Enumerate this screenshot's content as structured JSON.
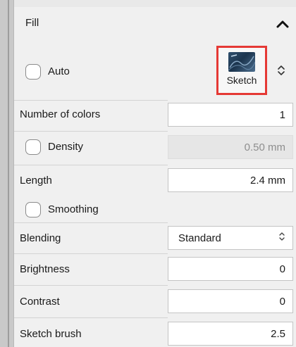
{
  "fill": {
    "title": "Fill",
    "auto_label": "Auto",
    "sketch_label": "Sketch",
    "rows": {
      "number_of_colors": {
        "label": "Number of colors",
        "value": "1"
      },
      "density": {
        "label": "Density",
        "value": "0.50 mm"
      },
      "length": {
        "label": "Length",
        "value": "2.4 mm"
      },
      "smoothing": {
        "label": "Smoothing"
      },
      "blending": {
        "label": "Blending",
        "value": "Standard"
      },
      "brightness": {
        "label": "Brightness",
        "value": "0"
      },
      "contrast": {
        "label": "Contrast",
        "value": "0"
      },
      "sketch_brush": {
        "label": "Sketch brush",
        "value": "2.5"
      }
    }
  },
  "colors": {
    "highlight": "#e53935",
    "panel": "#f0f0f0"
  },
  "icons": {
    "collapse": "chevron-up-icon",
    "mode_selector": "up-down-arrows-icon",
    "select_arrow": "up-down-arrows-icon"
  }
}
